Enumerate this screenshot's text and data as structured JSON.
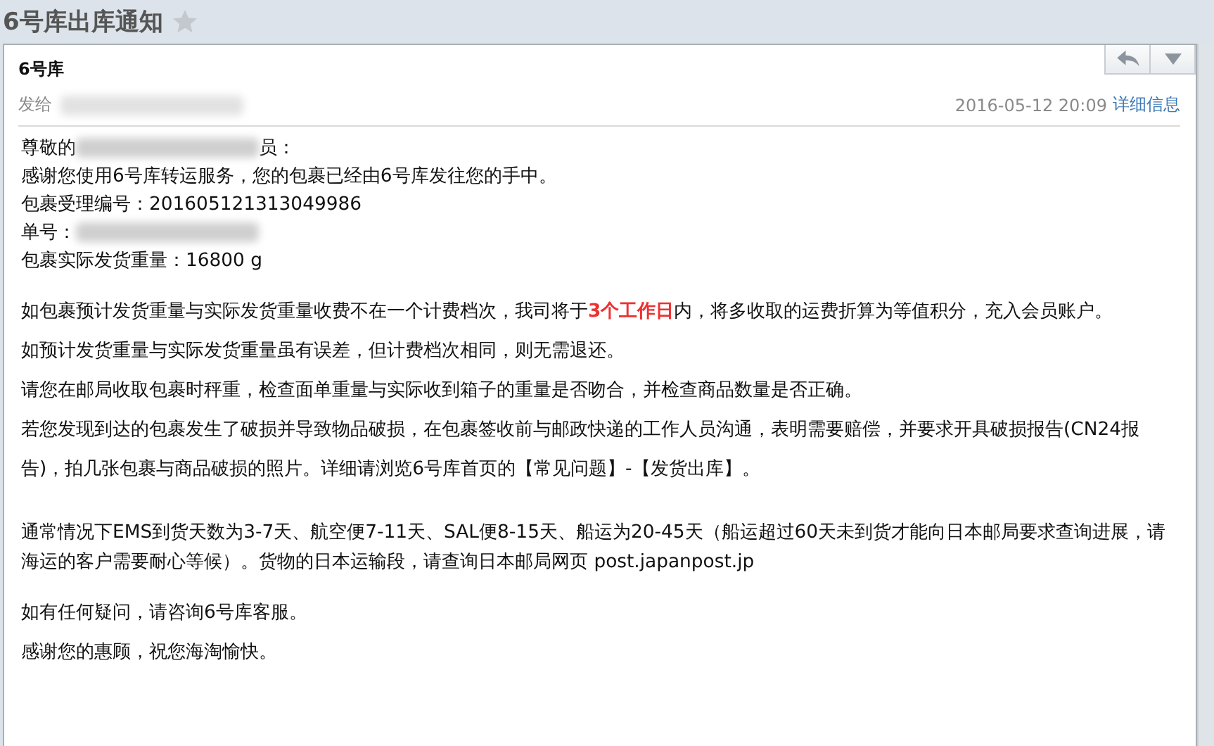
{
  "subject": {
    "title": "6号库出库通知",
    "starred": false
  },
  "message": {
    "sender": "6号库",
    "to_label": "发给",
    "date": "2016-05-12 20:09",
    "details_link": "详细信息"
  },
  "body": [
    {
      "kind": "compact",
      "lines": [
        {
          "parts": [
            "尊敬的",
            "员："
          ],
          "redacted": true
        },
        {
          "parts": [
            "感谢您使用6号库转运服务，您的包裹已经由6号库发往您的手中。"
          ],
          "redacted": false
        },
        {
          "parts": [
            "包裹受理编号：201605121313049986"
          ],
          "redacted": false
        },
        {
          "parts": [
            "单号："
          ],
          "redacted": true
        },
        {
          "parts": [
            "包裹实际发货重量：16800 g"
          ],
          "redacted": false
        }
      ]
    },
    {
      "kind": "loose",
      "lines": [
        {
          "parts": [
            "如包裹预计发货重量与实际发货重量收费不在一个计费档次，我司将于**3个工作日**内，将多收取的运费折算为等值积分，充入会员账户。"
          ],
          "redacted": false
        },
        {
          "parts": [
            "如预计发货重量与实际发货重量虽有误差，但计费档次相同，则无需退还。"
          ],
          "redacted": false
        },
        {
          "parts": [
            "请您在邮局收取包裹时秤重，检查面单重量与实际收到箱子的重量是否吻合，并检查商品数量是否正确。"
          ],
          "redacted": false
        },
        {
          "parts": [
            "若您发现到达的包裹发生了破损并导致物品破损，在包裹签收前与邮政快递的工作人员沟通，表明需要赔偿，并要求开具破损报告(CN24报告)，拍几张包裹与商品破损的照片。详细请浏览6号库首页的【常见问题】-【发货出库】。"
          ],
          "redacted": false
        }
      ]
    },
    {
      "kind": "normal",
      "lines": [
        {
          "parts": [
            "通常情况下EMS到货天数为3-7天、航空便7-11天、SAL便8-15天、船运为20-45天（船运超过60天未到货才能向日本邮局要求查询进展，请海运的客户需要耐心等候）。货物的日本运输段，请查询日本邮局网页 post.japanpost.jp"
          ],
          "redacted": false
        }
      ]
    },
    {
      "kind": "loose",
      "lines": [
        {
          "parts": [
            "如有任何疑问，请咨询6号库客服。"
          ],
          "redacted": false
        },
        {
          "parts": [
            "感谢您的惠顾，祝您海淘愉快。"
          ],
          "redacted": false
        }
      ]
    }
  ]
}
